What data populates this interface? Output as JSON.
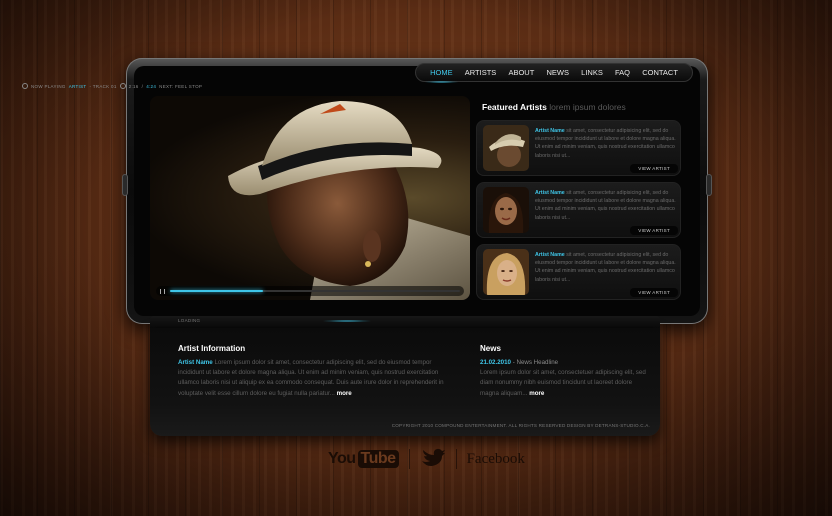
{
  "status": {
    "now_playing_label": "NOW PLAYING",
    "artist": "ARTIST",
    "track": "- TRACK 01",
    "time_current": "2:16",
    "time_total": "4:24",
    "next": "NEXT: FEEL STOP"
  },
  "nav": {
    "items": [
      {
        "label": "HOME",
        "active": true
      },
      {
        "label": "ARTISTS",
        "active": false
      },
      {
        "label": "ABOUT",
        "active": false
      },
      {
        "label": "NEWS",
        "active": false
      },
      {
        "label": "LINKS",
        "active": false
      },
      {
        "label": "FAQ",
        "active": false
      },
      {
        "label": "CONTACT",
        "active": false
      }
    ]
  },
  "player": {
    "progress": 0.32
  },
  "featured": {
    "title": "Featured Artists",
    "subtitle": "lorem ipsum dolores",
    "cards": [
      {
        "name": "Artist Name",
        "text": "sit amet, consectetur adipisicing elit, sed do eiusmod tempor incididunt ut labore et dolore magna aliqua. Ut enim ad minim veniam, quis nostrud exercitation ullamco laboris nisi ut...",
        "button": "VIEW ARTIST"
      },
      {
        "name": "Artist Name",
        "text": "sit amet, consectetur adipisicing elit, sed do eiusmod tempor incididunt ut labore et dolore magna aliqua. Ut enim ad minim veniam, quis nostrud exercitation ullamco laboris nisi ut...",
        "button": "VIEW ARTIST"
      },
      {
        "name": "Artist Name",
        "text": "sit amet, consectetur adipisicing elit, sed do eiusmod tempor incididunt ut labore et dolore magna aliqua. Ut enim ad minim veniam, quis nostrud exercitation ullamco laboris nisi ut...",
        "button": "VIEW ARTIST"
      }
    ]
  },
  "lower_tag": "LOADING",
  "artist_info": {
    "title": "Artist Information",
    "name": "Artist Name",
    "text": "Lorem ipsum dolor sit amet, consectetur adipiscing elit, sed do eiusmod tempor incididunt ut labore et dolore magna aliqua. Ut enim ad minim veniam, quis nostrud exercitation ullamco laboris nisi ut aliquip ex ea commodo consequat. Duis aute irure dolor in reprehenderit in voluptate velit esse cillum dolore eu fugiat nulla pariatur...",
    "more": "more"
  },
  "news": {
    "title": "News",
    "date": "21.02.2010",
    "headline": "- News Headline",
    "text": "Lorem ipsum dolor sit amet, consectetuer adipiscing elit, sed diam nonummy nibh euismod tincidunt ut laoreet dolore magna aliquam...",
    "more": "more"
  },
  "footer": {
    "copyright": "COPYRIGHT 2010 COMPOUND ENTERTAINMENT.  ALL RIGHTS RESERVED   DESIGN BY DETRANS-STUDIO.C.A."
  },
  "social": {
    "youtube_you": "You",
    "youtube_tube": "Tube",
    "facebook": "Facebook"
  },
  "colors": {
    "accent": "#3fc6e8",
    "wood": "#5a2c14"
  }
}
